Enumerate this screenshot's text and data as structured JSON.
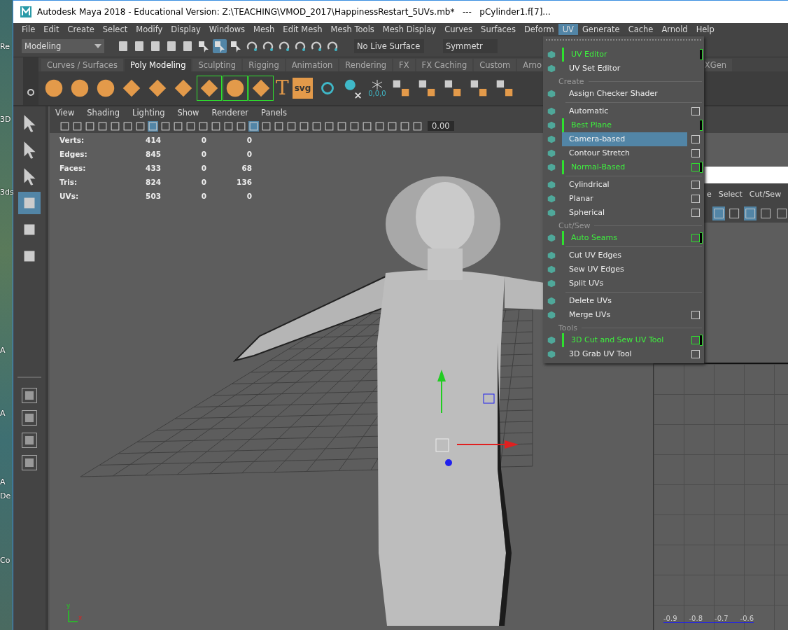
{
  "desktop_labels": [
    "Re",
    "3D",
    "3ds",
    "A",
    "A",
    "A",
    "De",
    "Co"
  ],
  "window": {
    "title": "Autodesk Maya 2018 - Educational Version: Z:\\TEACHING\\VMOD_2017\\HappinessRestart_5UVs.mb*   ---   pCylinder1.f[7]..."
  },
  "menu_bar": [
    {
      "label": "File",
      "selected": false
    },
    {
      "label": "Edit",
      "selected": false
    },
    {
      "label": "Create",
      "selected": false
    },
    {
      "label": "Select",
      "selected": false
    },
    {
      "label": "Modify",
      "selected": false
    },
    {
      "label": "Display",
      "selected": false
    },
    {
      "label": "Windows",
      "selected": false
    },
    {
      "label": "Mesh",
      "selected": false
    },
    {
      "label": "Edit Mesh",
      "selected": false
    },
    {
      "label": "Mesh Tools",
      "selected": false
    },
    {
      "label": "Mesh Display",
      "selected": false
    },
    {
      "label": "Curves",
      "selected": false
    },
    {
      "label": "Surfaces",
      "selected": false
    },
    {
      "label": "Deform",
      "selected": false
    },
    {
      "label": "UV",
      "selected": true
    },
    {
      "label": "Generate",
      "selected": false
    },
    {
      "label": "Cache",
      "selected": false
    },
    {
      "label": "Arnold",
      "selected": false
    },
    {
      "label": "Help",
      "selected": false
    }
  ],
  "status_line": {
    "menu_set": "Modeling",
    "live_surface": "No Live Surface",
    "symmetry": "Symmetr"
  },
  "shelf_tabs": [
    {
      "label": "Curves / Surfaces",
      "selected": false
    },
    {
      "label": "Poly Modeling",
      "selected": true
    },
    {
      "label": "Sculpting",
      "selected": false
    },
    {
      "label": "Rigging",
      "selected": false
    },
    {
      "label": "Animation",
      "selected": false
    },
    {
      "label": "Rendering",
      "selected": false
    },
    {
      "label": "FX",
      "selected": false
    },
    {
      "label": "FX Caching",
      "selected": false
    },
    {
      "label": "Custom",
      "selected": false
    },
    {
      "label": "Arno",
      "selected": false
    },
    {
      "label": "XGen",
      "selected": false
    }
  ],
  "shelf_badge": "0,0,0",
  "shelf_text_buttons": [
    "T",
    "svg"
  ],
  "panel_menu": [
    "View",
    "Shading",
    "Lighting",
    "Show",
    "Renderer",
    "Panels"
  ],
  "panel_toolbar": {
    "value": "0.00"
  },
  "poly_count": [
    {
      "label": "Verts:",
      "values": [
        "414",
        "0",
        "0"
      ]
    },
    {
      "label": "Edges:",
      "values": [
        "845",
        "0",
        "0"
      ]
    },
    {
      "label": "Faces:",
      "values": [
        "433",
        "0",
        "68"
      ]
    },
    {
      "label": "Tris:",
      "values": [
        "824",
        "0",
        "136"
      ]
    },
    {
      "label": "UVs:",
      "values": [
        "503",
        "0",
        "0"
      ]
    }
  ],
  "axis_labels": [
    "y",
    "x"
  ],
  "uv_editor": {
    "menu": [
      "e",
      "Select",
      "Cut/Sew"
    ],
    "axis_ticks": [
      "-0.9",
      "-0.8",
      "-0.7",
      "-0.6"
    ]
  },
  "uv_menu": [
    {
      "kind": "item",
      "label": "UV Editor",
      "marked": true,
      "option_box": false,
      "selected": false
    },
    {
      "kind": "item",
      "label": "UV Set Editor",
      "marked": false,
      "option_box": false,
      "selected": false
    },
    {
      "kind": "section",
      "label": "Create"
    },
    {
      "kind": "item",
      "label": "Assign Checker Shader",
      "marked": false,
      "option_box": false,
      "selected": false
    },
    {
      "kind": "separator"
    },
    {
      "kind": "item",
      "label": "Automatic",
      "marked": false,
      "option_box": true,
      "selected": false
    },
    {
      "kind": "item",
      "label": "Best Plane",
      "marked": true,
      "option_box": false,
      "selected": false
    },
    {
      "kind": "item",
      "label": "Camera-based",
      "marked": false,
      "option_box": true,
      "selected": true
    },
    {
      "kind": "item",
      "label": "Contour Stretch",
      "marked": false,
      "option_box": true,
      "selected": false
    },
    {
      "kind": "item",
      "label": "Normal-Based",
      "marked": true,
      "option_box": true,
      "selected": false
    },
    {
      "kind": "separator"
    },
    {
      "kind": "item",
      "label": "Cylindrical",
      "marked": false,
      "option_box": true,
      "selected": false
    },
    {
      "kind": "item",
      "label": "Planar",
      "marked": false,
      "option_box": true,
      "selected": false
    },
    {
      "kind": "item",
      "label": "Spherical",
      "marked": false,
      "option_box": true,
      "selected": false
    },
    {
      "kind": "section",
      "label": "Cut/Sew"
    },
    {
      "kind": "item",
      "label": "Auto Seams",
      "marked": true,
      "option_box": true,
      "selected": false
    },
    {
      "kind": "separator"
    },
    {
      "kind": "item",
      "label": "Cut UV Edges",
      "marked": false,
      "option_box": false,
      "selected": false
    },
    {
      "kind": "item",
      "label": "Sew UV Edges",
      "marked": false,
      "option_box": false,
      "selected": false
    },
    {
      "kind": "item",
      "label": "Split UVs",
      "marked": false,
      "option_box": false,
      "selected": false
    },
    {
      "kind": "separator"
    },
    {
      "kind": "item",
      "label": "Delete UVs",
      "marked": false,
      "option_box": false,
      "selected": false
    },
    {
      "kind": "item",
      "label": "Merge UVs",
      "marked": false,
      "option_box": true,
      "selected": false
    },
    {
      "kind": "section",
      "label": "Tools"
    },
    {
      "kind": "item",
      "label": "3D Cut and Sew UV Tool",
      "marked": true,
      "option_box": true,
      "selected": false
    },
    {
      "kind": "item",
      "label": "3D Grab UV Tool",
      "marked": false,
      "option_box": true,
      "selected": false
    }
  ]
}
